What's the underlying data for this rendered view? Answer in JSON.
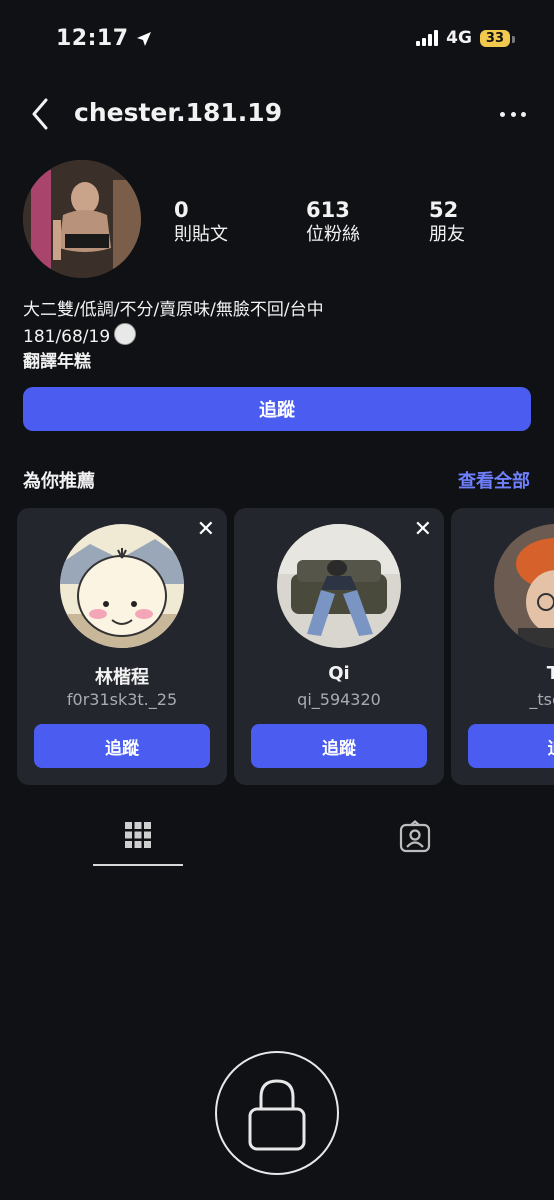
{
  "status": {
    "time": "12:17",
    "network": "4G",
    "battery": "33"
  },
  "header": {
    "username": "chester.181.19"
  },
  "stats": [
    {
      "num": "0",
      "label": "則貼文"
    },
    {
      "num": "613",
      "label": "位粉絲"
    },
    {
      "num": "52",
      "label": "朋友"
    }
  ],
  "bio": {
    "line1": "大二雙/低調/不分/賣原味/無臉不回/台中",
    "line2": "181/68/19",
    "translate": "翻譯年糕"
  },
  "follow_label": "追蹤",
  "suggestions": {
    "title": "為你推薦",
    "see_all": "查看全部",
    "cards": [
      {
        "name": "林楷程",
        "handle": "f0r31sk3t._25",
        "button": "追蹤"
      },
      {
        "name": "Qi",
        "handle": "qi_594320",
        "button": "追蹤"
      },
      {
        "name": "Ti",
        "handle": "_tsetin",
        "button": "追"
      }
    ]
  },
  "colors": {
    "accent": "#4a5df0",
    "link": "#6e80ff",
    "background": "#0f1115",
    "card": "#23262d"
  }
}
